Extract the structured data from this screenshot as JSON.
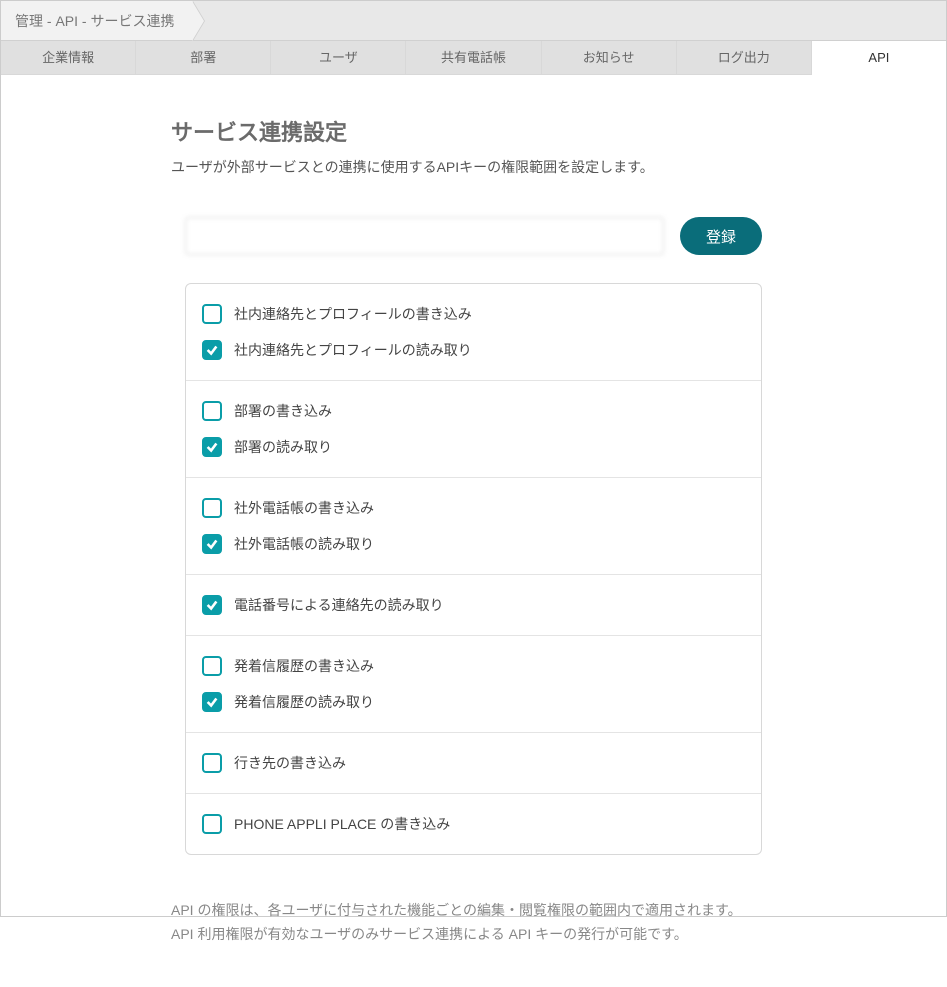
{
  "breadcrumb": {
    "label": "管理 - API - サービス連携"
  },
  "tabs": [
    {
      "label": "企業情報",
      "active": false
    },
    {
      "label": "部署",
      "active": false
    },
    {
      "label": "ユーザ",
      "active": false
    },
    {
      "label": "共有電話帳",
      "active": false
    },
    {
      "label": "お知らせ",
      "active": false
    },
    {
      "label": "ログ出力",
      "active": false
    },
    {
      "label": "API",
      "active": true
    }
  ],
  "page": {
    "title": "サービス連携設定",
    "desc": "ユーザが外部サービスとの連携に使用するAPIキーの権限範囲を設定します。"
  },
  "form": {
    "input_value": "                              ",
    "submit_label": "登録"
  },
  "perm_groups": [
    {
      "items": [
        {
          "label": "社内連絡先とプロフィールの書き込み",
          "checked": false
        },
        {
          "label": "社内連絡先とプロフィールの読み取り",
          "checked": true
        }
      ]
    },
    {
      "items": [
        {
          "label": "部署の書き込み",
          "checked": false
        },
        {
          "label": "部署の読み取り",
          "checked": true
        }
      ]
    },
    {
      "items": [
        {
          "label": "社外電話帳の書き込み",
          "checked": false
        },
        {
          "label": "社外電話帳の読み取り",
          "checked": true
        }
      ]
    },
    {
      "items": [
        {
          "label": "電話番号による連絡先の読み取り",
          "checked": true
        }
      ]
    },
    {
      "items": [
        {
          "label": "発着信履歴の書き込み",
          "checked": false
        },
        {
          "label": "発着信履歴の読み取り",
          "checked": true
        }
      ]
    },
    {
      "items": [
        {
          "label": "行き先の書き込み",
          "checked": false
        }
      ]
    },
    {
      "items": [
        {
          "label": "PHONE APPLI PLACE の書き込み",
          "checked": false
        }
      ]
    }
  ],
  "footnote": {
    "line1": "API の権限は、各ユーザに付与された機能ごとの編集・閲覧権限の範囲内で適用されます。",
    "line2": "API 利用権限が有効なユーザのみサービス連携による API キーの発行が可能です。"
  }
}
